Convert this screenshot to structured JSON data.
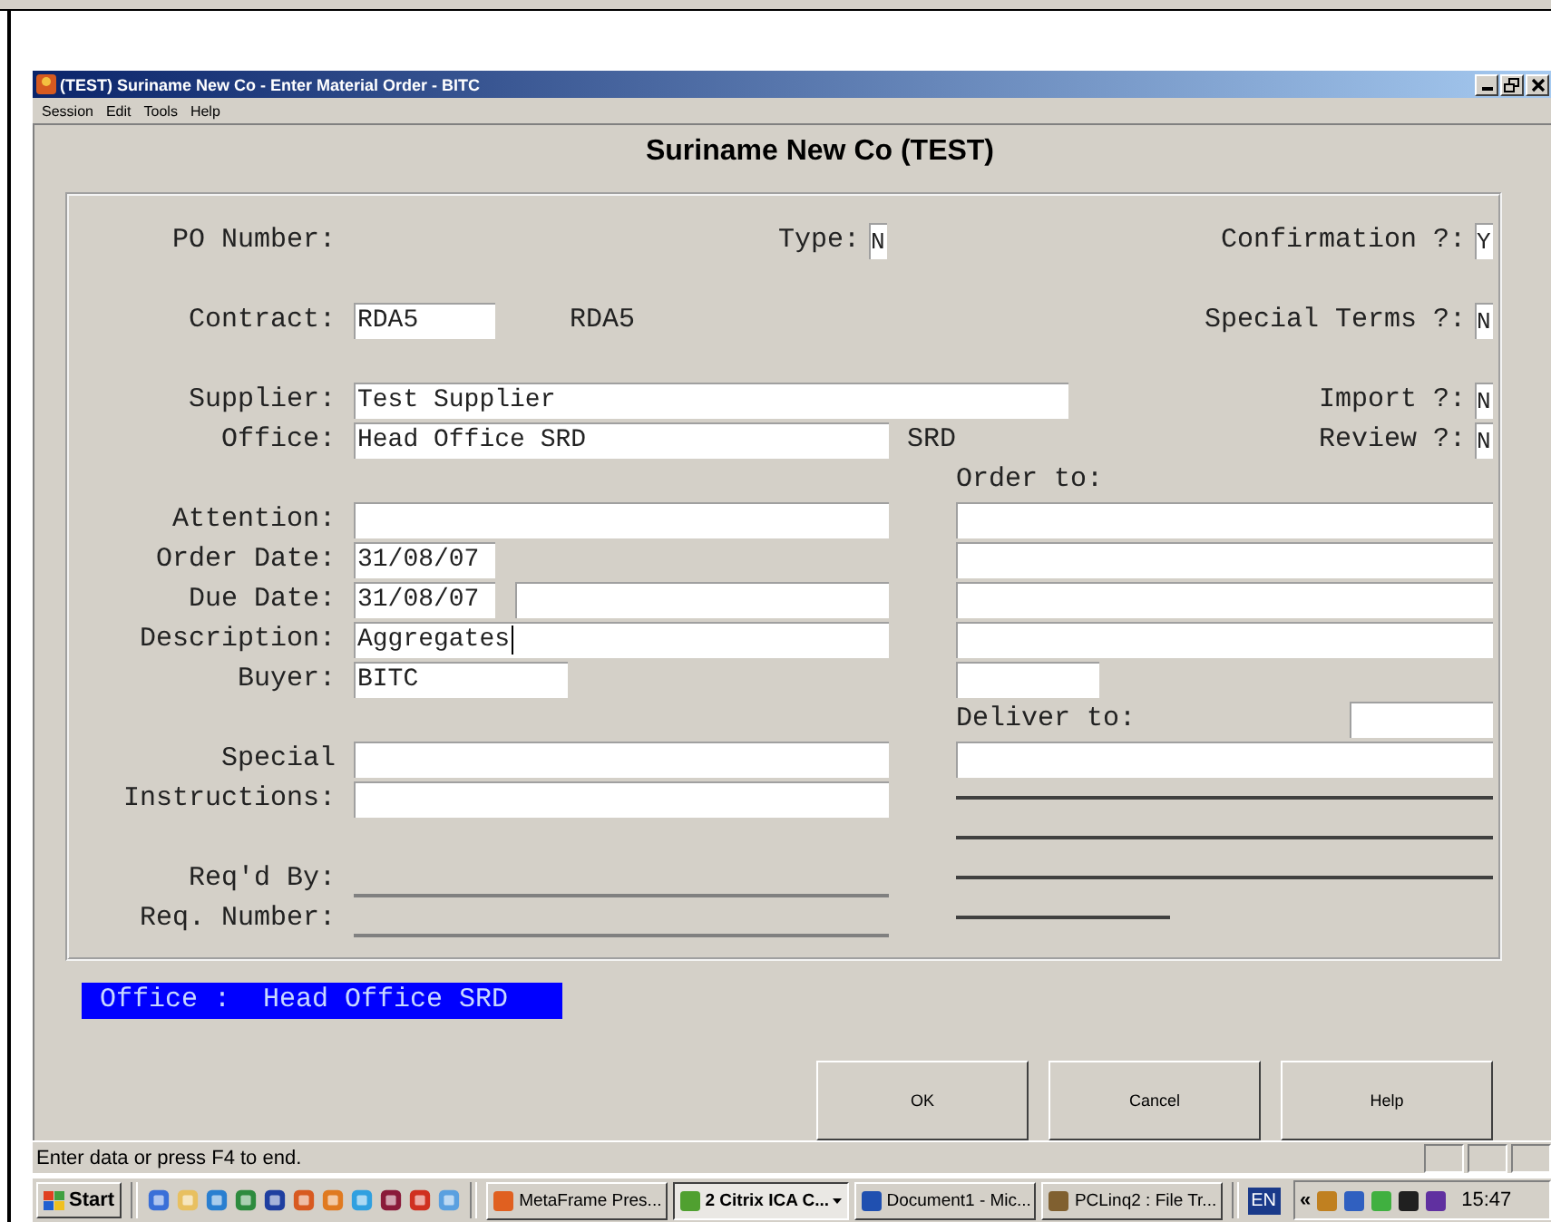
{
  "window": {
    "title": "(TEST) Suriname New Co - Enter Material Order - BITC"
  },
  "menu": [
    "Session",
    "Edit",
    "Tools",
    "Help"
  ],
  "heading": "Suriname New Co (TEST)",
  "header": {
    "po_number": {
      "label": "PO Number:"
    },
    "type": {
      "label": "Type:",
      "value": "N"
    },
    "confirmation": {
      "label": "Confirmation ?:",
      "value": "Y"
    },
    "contract": {
      "label": "Contract:",
      "value": "RDA5",
      "description": "RDA5"
    },
    "special_terms": {
      "label": "Special Terms ?:",
      "value": "N"
    },
    "supplier": {
      "label": "Supplier:",
      "value": "Test Supplier"
    },
    "import": {
      "label": "Import ?:",
      "value": "N"
    },
    "office": {
      "label": "Office:",
      "value": "Head Office SRD",
      "currency": "SRD"
    },
    "review": {
      "label": "Review ?:",
      "value": "N"
    }
  },
  "left_rows": [
    {
      "kind": "blank"
    },
    {
      "kind": "field",
      "label": "Attention:",
      "focused": false
    },
    {
      "kind": "date",
      "label": "Order Date:",
      "value": "31/08/07",
      "focused": false
    },
    {
      "kind": "date_pair",
      "label": "Due Date:",
      "value": "31/08/07",
      "focused": false
    },
    {
      "kind": "field",
      "label": "Description:",
      "value": "Aggregates",
      "focused": true
    },
    {
      "kind": "short",
      "label": "Buyer:",
      "value": "BITC",
      "focused": false
    },
    {
      "kind": "blank"
    },
    {
      "kind": "field",
      "label": "Special",
      "focused": false
    },
    {
      "kind": "field",
      "label": "Instructions:",
      "focused": false
    },
    {
      "kind": "blank"
    },
    {
      "kind": "line",
      "label": "Req'd By:"
    },
    {
      "kind": "line",
      "label": "Req. Number:"
    }
  ],
  "right_rows": [
    {
      "kind": "heading",
      "label": "Order to:"
    },
    {
      "kind": "field"
    },
    {
      "kind": "field"
    },
    {
      "kind": "field"
    },
    {
      "kind": "field"
    },
    {
      "kind": "short"
    },
    {
      "kind": "heading_field",
      "label": "Deliver to:"
    },
    {
      "kind": "field"
    },
    {
      "kind": "line"
    },
    {
      "kind": "line"
    },
    {
      "kind": "line"
    },
    {
      "kind": "short_line"
    }
  ],
  "office_banner": "Office :  Head Office SRD",
  "buttons": [
    "OK",
    "Cancel",
    "Help"
  ],
  "status_bar": "Enter data or press F4 to end.",
  "taskbar": {
    "start": "Start",
    "tasks": [
      {
        "label": "MetaFrame Pres...",
        "selected": false,
        "grouped": false
      },
      {
        "label": "2 Citrix ICA C...",
        "selected": true,
        "grouped": true
      },
      {
        "label": "Document1 - Mic...",
        "selected": false,
        "grouped": false
      },
      {
        "label": "PCLinq2 : File Tr...",
        "selected": false,
        "grouped": false
      }
    ],
    "language": "EN",
    "tray_chevron": "«",
    "clock": "15:47"
  }
}
